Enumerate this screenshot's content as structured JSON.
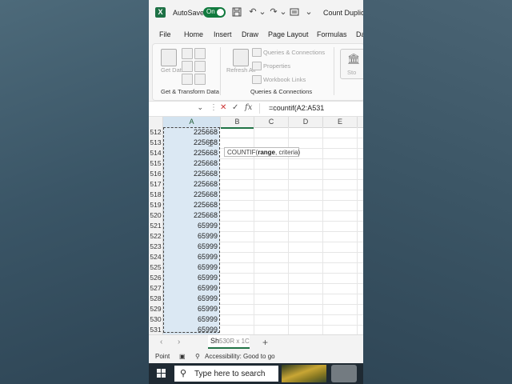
{
  "titlebar": {
    "app_logo": "X",
    "autosave_label": "AutoSave",
    "autosave_state": "On",
    "doc_title": "Count Duplica",
    "icons": [
      "save-icon",
      "undo-icon",
      "redo-icon",
      "customize-icon",
      "more-icon"
    ]
  },
  "menu": [
    "File",
    "Home",
    "Insert",
    "Draw",
    "Page Layout",
    "Formulas",
    "Da"
  ],
  "ribbon": {
    "get_data_label": "Get Data",
    "get_transform_label": "Get & Transform Data",
    "refresh_label": "Refresh All",
    "queries_connections": "Queries & Connections",
    "properties": "Properties",
    "workbook_links": "Workbook Links",
    "queries_group_label": "Queries & Connections",
    "stocks_partial": "Sto"
  },
  "formula_bar": {
    "namebox": "",
    "cancel": "✕",
    "enter": "✓",
    "fx": "fx",
    "formula": "=countif(A2:A531"
  },
  "columns": [
    "A",
    "B",
    "C",
    "D",
    "E"
  ],
  "rows": [
    {
      "n": "512",
      "a": "225668"
    },
    {
      "n": "513",
      "a": "225668"
    },
    {
      "n": "514",
      "a": "225668"
    },
    {
      "n": "515",
      "a": "225668"
    },
    {
      "n": "516",
      "a": "225668"
    },
    {
      "n": "517",
      "a": "225668"
    },
    {
      "n": "518",
      "a": "225668"
    },
    {
      "n": "519",
      "a": "225668"
    },
    {
      "n": "520",
      "a": "225668"
    },
    {
      "n": "521",
      "a": "65999"
    },
    {
      "n": "522",
      "a": "65999"
    },
    {
      "n": "523",
      "a": "65999"
    },
    {
      "n": "524",
      "a": "65999"
    },
    {
      "n": "525",
      "a": "65999"
    },
    {
      "n": "526",
      "a": "65999"
    },
    {
      "n": "527",
      "a": "65999"
    },
    {
      "n": "528",
      "a": "65999"
    },
    {
      "n": "529",
      "a": "65999"
    },
    {
      "n": "530",
      "a": "65999"
    },
    {
      "n": "531",
      "a": "65999"
    }
  ],
  "tooltip": {
    "func": "COUNTIF(",
    "arg1": "range",
    ", criteria)": ", criteria)"
  },
  "sheet": {
    "tab_label": "Sh",
    "size_hint": "530R x 1C"
  },
  "status": {
    "mode": "Point",
    "accessibility": "Accessibility: Good to go"
  },
  "taskbar": {
    "search_placeholder": "Type here to search"
  }
}
